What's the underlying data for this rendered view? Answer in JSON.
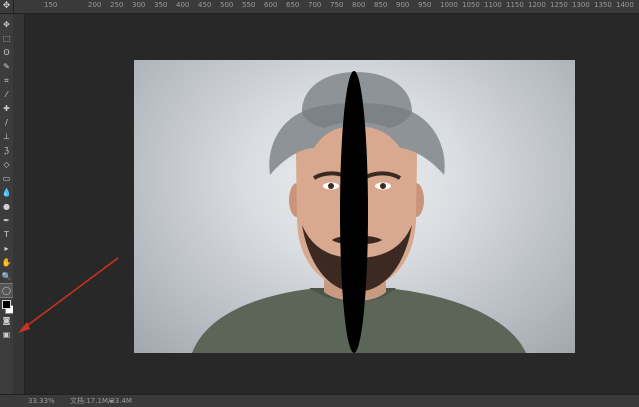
{
  "app": {
    "corner_icon": "move-cross-icon"
  },
  "ruler": {
    "labels": [
      "",
      "150",
      "",
      "200",
      "250",
      "300",
      "350",
      "400",
      "450",
      "500",
      "550",
      "600",
      "650",
      "700",
      "750",
      "800",
      "850",
      "900",
      "950",
      "1000",
      "1050",
      "1100",
      "1150",
      "1200",
      "1250",
      "1300",
      "1350",
      "1400"
    ]
  },
  "tools": [
    {
      "name": "move-tool-icon",
      "glyph": "✥"
    },
    {
      "name": "marquee-tool-icon",
      "glyph": "⬚"
    },
    {
      "name": "lasso-tool-icon",
      "glyph": "ʘ"
    },
    {
      "name": "quick-select-tool-icon",
      "glyph": "✎"
    },
    {
      "name": "crop-tool-icon",
      "glyph": "⌗"
    },
    {
      "name": "eyedropper-tool-icon",
      "glyph": "⁄"
    },
    {
      "name": "healing-brush-tool-icon",
      "glyph": "✚"
    },
    {
      "name": "brush-tool-icon",
      "glyph": "/"
    },
    {
      "name": "clone-stamp-tool-icon",
      "glyph": "⊥"
    },
    {
      "name": "history-brush-tool-icon",
      "glyph": "ℨ"
    },
    {
      "name": "eraser-tool-icon",
      "glyph": "◇"
    },
    {
      "name": "gradient-tool-icon",
      "glyph": "▭"
    },
    {
      "name": "blur-tool-icon",
      "glyph": "💧"
    },
    {
      "name": "dodge-tool-icon",
      "glyph": "●"
    },
    {
      "name": "pen-tool-icon",
      "glyph": "✒"
    },
    {
      "name": "type-tool-icon",
      "glyph": "T"
    },
    {
      "name": "path-select-tool-icon",
      "glyph": "▸"
    },
    {
      "name": "hand-tool-icon",
      "glyph": "✋"
    },
    {
      "name": "zoom-tool-icon",
      "glyph": "🔍"
    },
    {
      "name": "ellipse-tool-icon",
      "glyph": "◯",
      "active": true
    },
    {
      "name": "quick-mask-icon",
      "glyph": "◙"
    },
    {
      "name": "screen-mode-icon",
      "glyph": "▣"
    }
  ],
  "status": {
    "zoom": "33.33%",
    "doc": "文档:17.1M/33.4M"
  },
  "colors": {
    "annotation_arrow": "#c8321e",
    "ellipse_shape": "#000000"
  }
}
